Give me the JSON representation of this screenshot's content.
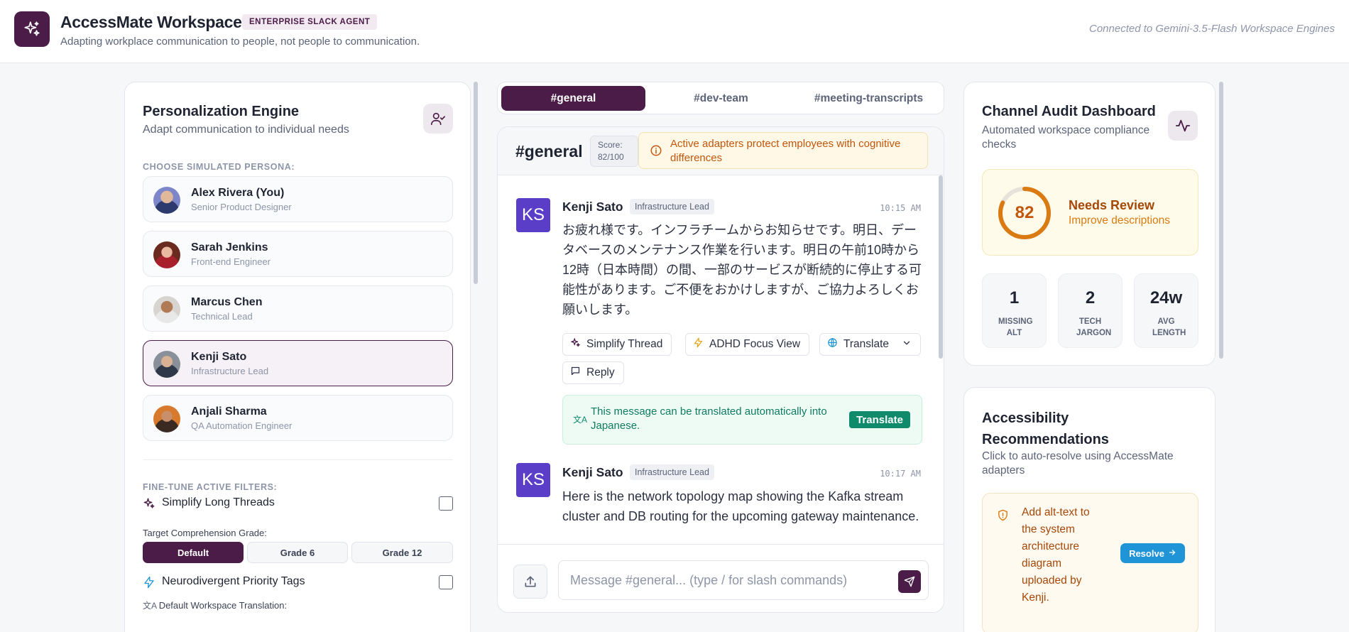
{
  "header": {
    "title": "AccessMate Workspace",
    "badge": "ENTERPRISE SLACK AGENT",
    "subtitle": "Adapting workplace communication to people, not people to communication.",
    "connection": "Connected to Gemini-3.5-Flash Workspace Engines"
  },
  "personalization": {
    "title": "Personalization Engine",
    "subtitle": "Adapt communication to individual needs",
    "persona_label": "CHOOSE SIMULATED PERSONA:",
    "personas": [
      {
        "name": "Alex Rivera (You)",
        "role": "Senior Product Designer",
        "active": false
      },
      {
        "name": "Sarah Jenkins",
        "role": "Front-end Engineer",
        "active": false
      },
      {
        "name": "Marcus Chen",
        "role": "Technical Lead",
        "active": false
      },
      {
        "name": "Kenji Sato",
        "role": "Infrastructure Lead",
        "active": true
      },
      {
        "name": "Anjali Sharma",
        "role": "QA Automation Engineer",
        "active": false
      }
    ],
    "filters_label": "FINE-TUNE ACTIVE FILTERS:",
    "filters": {
      "simplify": "Simplify Long Threads",
      "neuro": "Neurodivergent Priority Tags"
    },
    "grade_label": "Target Comprehension Grade:",
    "grades": [
      "Default",
      "Grade 6",
      "Grade 12"
    ],
    "grade_selected": "Default",
    "translation_label": "Default Workspace Translation:"
  },
  "tabs": [
    "#general",
    "#dev-team",
    "#meeting-transcripts"
  ],
  "tab_selected": "#general",
  "chat": {
    "channel": "#general",
    "score_label": "Score:",
    "score_value": "82/100",
    "warning": "Active adapters protect employees with cognitive differences",
    "messages": [
      {
        "initials": "KS",
        "author": "Kenji Sato",
        "role": "Infrastructure Lead",
        "time": "10:15 AM",
        "body": "お疲れ様です。インフラチームからお知らせです。明日、データベースのメンテナンス作業を行います。明日の午前10時から12時（日本時間）の間、一部のサービスが断続的に停止する可能性があります。ご不便をおかけしますが、ご協力よろしくお願いします。"
      },
      {
        "initials": "KS",
        "author": "Kenji Sato",
        "role": "Infrastructure Lead",
        "time": "10:17 AM",
        "body": "Here is the network topology map showing the Kafka stream cluster and DB routing for the upcoming gateway maintenance."
      }
    ],
    "actions": {
      "simplify": "Simplify Thread",
      "adhd": "ADHD Focus View",
      "translate": "Translate",
      "reply": "Reply"
    },
    "translate_banner": "This message can be translated automatically into Japanese.",
    "translate_button": "Translate",
    "composer_placeholder": "Message #general... (type / for slash commands)"
  },
  "audit": {
    "title": "Channel Audit Dashboard",
    "subtitle": "Automated workspace compliance checks",
    "score": "82",
    "score_fraction": 0.82,
    "status": "Needs Review",
    "hint": "Improve descriptions",
    "stats": [
      {
        "value": "1",
        "label": "MISSING ALT"
      },
      {
        "value": "2",
        "label": "TECH JARGON"
      },
      {
        "value": "24w",
        "label": "AVG LENGTH"
      }
    ]
  },
  "recommendations": {
    "title": "Accessibility Recommendations",
    "subtitle": "Click to auto-resolve using AccessMate adapters",
    "items": [
      {
        "text": "Add alt-text to the system architecture diagram uploaded by Kenji.",
        "button": "Resolve"
      }
    ]
  },
  "colors": {
    "brand": "#4a1c47",
    "warning": "#c2560b",
    "success": "#0f8a6a",
    "action_blue": "#1f95d8"
  }
}
